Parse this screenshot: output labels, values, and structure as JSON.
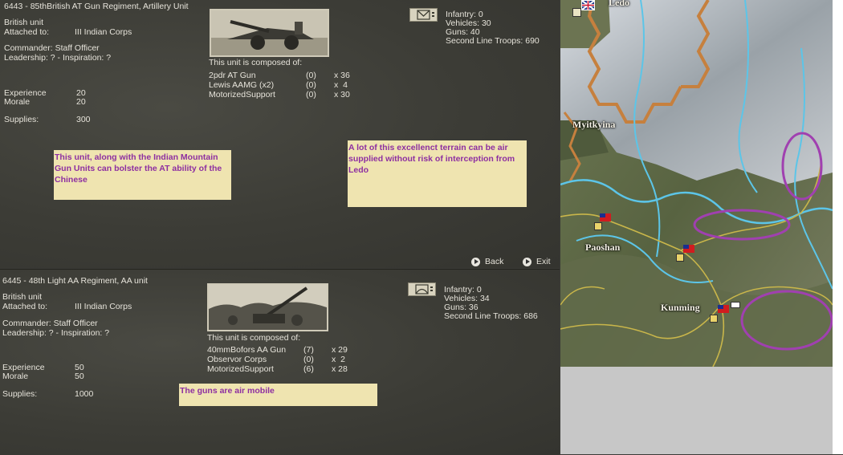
{
  "unit1": {
    "title": "6443 - 85thBritish AT Gun Regiment, Artillery Unit",
    "nationality": "British unit",
    "attached_label": "Attached to:",
    "attached_value": "III Indian Corps",
    "commander": "Commander: Staff Officer",
    "leadership": "Leadership: ? - Inspiration: ?",
    "experience_label": "Experience",
    "experience_value": "20",
    "morale_label": "Morale",
    "morale_value": "20",
    "supplies_label": "Supplies:",
    "supplies_value": "300",
    "composed_label": "This unit is composed of:",
    "components": [
      {
        "name": "2pdr AT Gun",
        "dmg": "(0)",
        "count": "x 36"
      },
      {
        "name": "Lewis AAMG (x2)",
        "dmg": "(0)",
        "count": "x  4"
      },
      {
        "name": "MotorizedSupport",
        "dmg": "(0)",
        "count": "x 30"
      }
    ],
    "stats": {
      "infantry": "Infantry: 0",
      "vehicles": "Vehicles: 30",
      "guns": "Guns: 40",
      "second_line": "Second Line Troops: 690"
    },
    "note_left": "This unit, along with the Indian Mountain Gun Units can bolster the AT ability of the Chinese",
    "note_right": "A lot of this excellenct terrain can be air supplied without risk of interception from Ledo"
  },
  "nav": {
    "back": "Back",
    "exit": "Exit"
  },
  "unit2": {
    "title": "6445 - 48th Light AA Regiment, AA unit",
    "nationality": "British unit",
    "attached_label": "Attached to:",
    "attached_value": "III Indian Corps",
    "commander": "Commander: Staff Officer",
    "leadership": "Leadership: ? - Inspiration: ?",
    "experience_label": "Experience",
    "experience_value": "50",
    "morale_label": "Morale",
    "morale_value": "50",
    "supplies_label": "Supplies:",
    "supplies_value": "1000",
    "composed_label": "This unit is composed of:",
    "components": [
      {
        "name": "40mmBofors AA Gun",
        "dmg": "(7)",
        "count": "x 29"
      },
      {
        "name": "Observor Corps",
        "dmg": "(0)",
        "count": "x  2"
      },
      {
        "name": "MotorizedSupport",
        "dmg": "(6)",
        "count": "x 28"
      }
    ],
    "stats": {
      "infantry": "Infantry: 0",
      "vehicles": "Vehicles: 34",
      "guns": "Guns: 36",
      "second_line": "Second Line Troops: 686"
    },
    "note": "The guns are air mobile"
  },
  "map": {
    "cities": {
      "ledo": "Ledo",
      "myitkyina": "Myitkyina",
      "paoshan": "Paoshan",
      "kunming": "Kunming"
    },
    "highlight_color": "#a040b0"
  }
}
